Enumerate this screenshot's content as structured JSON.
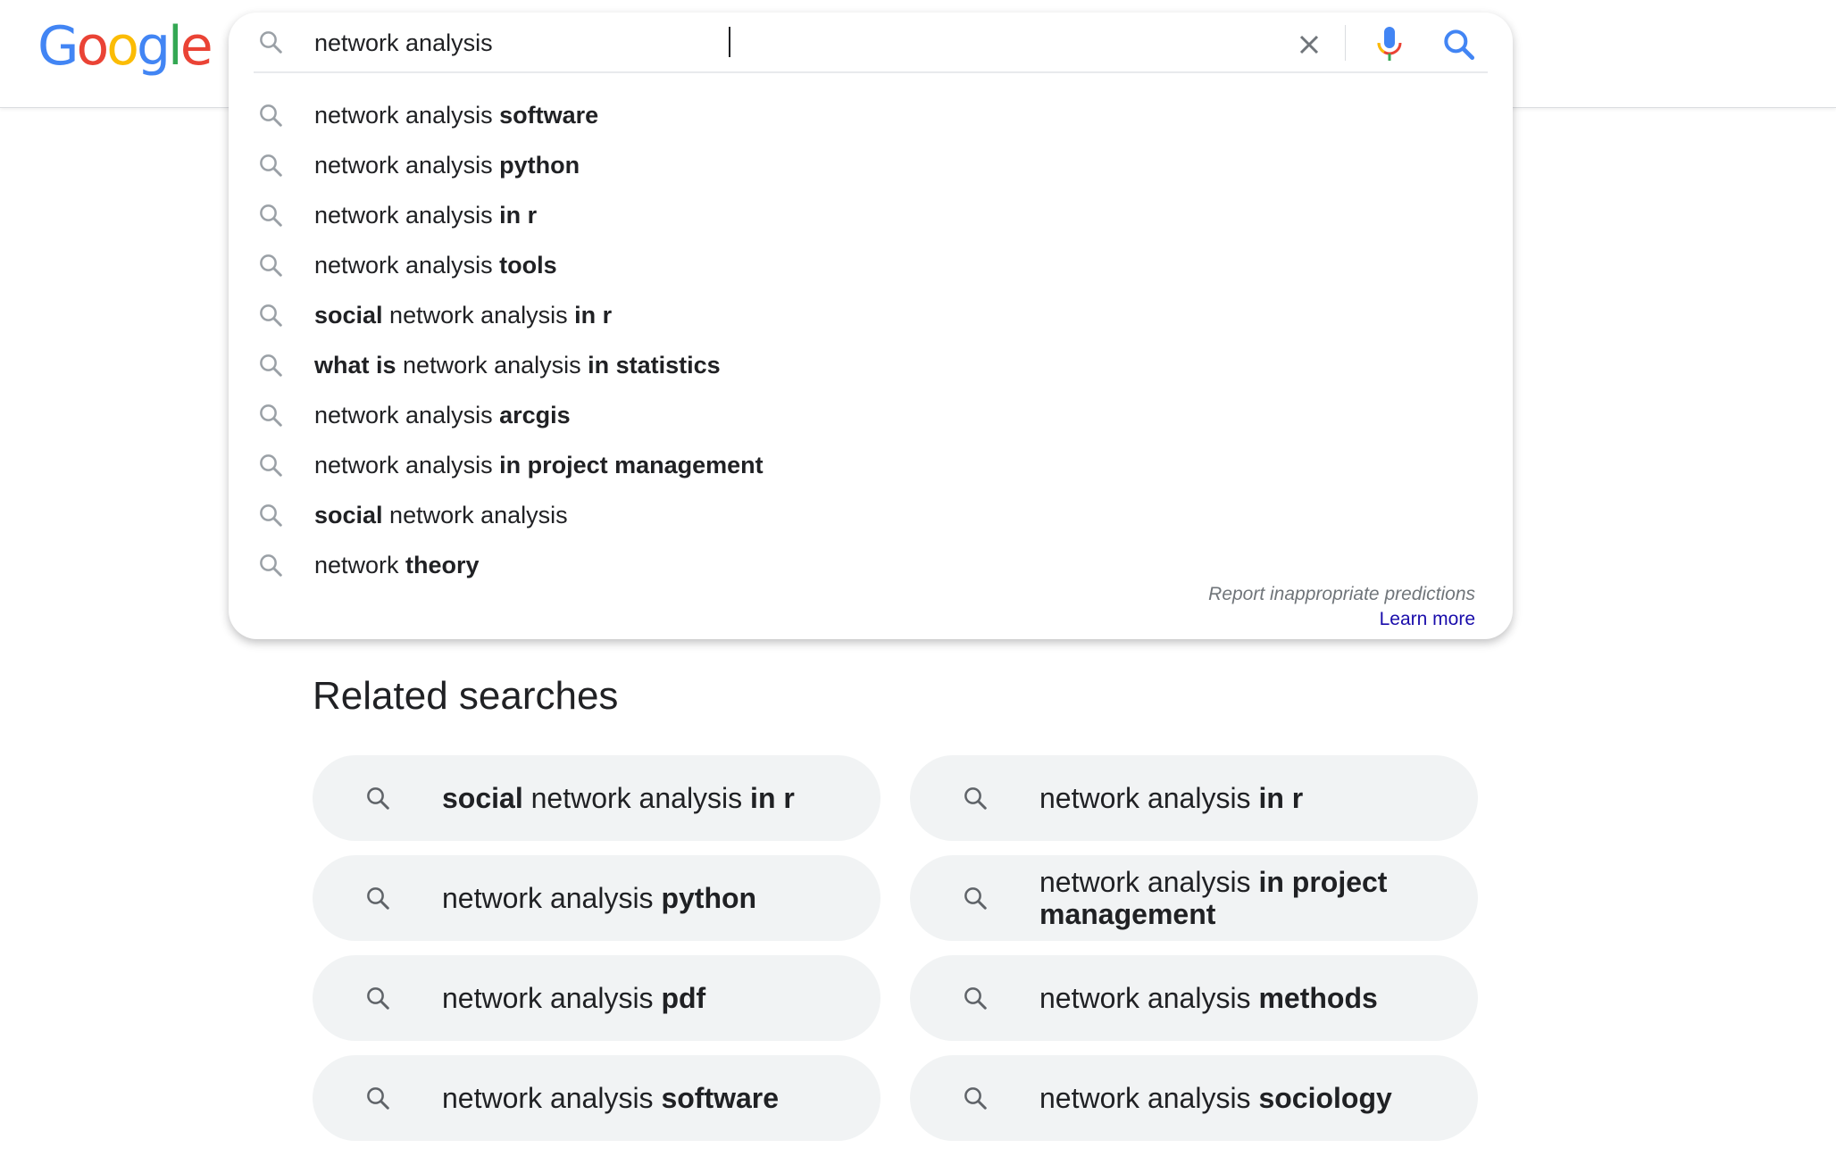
{
  "logo": {
    "letters": [
      {
        "ch": "G",
        "color": "#4285F4"
      },
      {
        "ch": "o",
        "color": "#EA4335"
      },
      {
        "ch": "o",
        "color": "#FBBC05"
      },
      {
        "ch": "g",
        "color": "#4285F4"
      },
      {
        "ch": "l",
        "color": "#34A853"
      },
      {
        "ch": "e",
        "color": "#EA4335"
      }
    ]
  },
  "search": {
    "query": "network analysis",
    "search_icon": "search-icon",
    "clear_icon": "close-icon",
    "mic_icon": "microphone-icon",
    "go_icon": "search-icon"
  },
  "suggestions": [
    {
      "parts": [
        {
          "t": "network analysis ",
          "b": false
        },
        {
          "t": "software",
          "b": true
        }
      ]
    },
    {
      "parts": [
        {
          "t": "network analysis ",
          "b": false
        },
        {
          "t": "python",
          "b": true
        }
      ]
    },
    {
      "parts": [
        {
          "t": "network analysis ",
          "b": false
        },
        {
          "t": "in r",
          "b": true
        }
      ]
    },
    {
      "parts": [
        {
          "t": "network analysis ",
          "b": false
        },
        {
          "t": "tools",
          "b": true
        }
      ]
    },
    {
      "parts": [
        {
          "t": "social",
          "b": true
        },
        {
          "t": " network analysis ",
          "b": false
        },
        {
          "t": "in r",
          "b": true
        }
      ]
    },
    {
      "parts": [
        {
          "t": "what is",
          "b": true
        },
        {
          "t": " network analysis ",
          "b": false
        },
        {
          "t": "in statistics",
          "b": true
        }
      ]
    },
    {
      "parts": [
        {
          "t": "network analysis ",
          "b": false
        },
        {
          "t": "arcgis",
          "b": true
        }
      ]
    },
    {
      "parts": [
        {
          "t": "network analysis ",
          "b": false
        },
        {
          "t": "in project management",
          "b": true
        }
      ]
    },
    {
      "parts": [
        {
          "t": "social",
          "b": true
        },
        {
          "t": " network analysis",
          "b": false
        }
      ]
    },
    {
      "parts": [
        {
          "t": "network ",
          "b": false
        },
        {
          "t": "theory",
          "b": true
        }
      ]
    }
  ],
  "footer": {
    "report": "Report inappropriate predictions",
    "learn_more": "Learn more"
  },
  "related": {
    "title": "Related searches",
    "items": [
      {
        "parts": [
          {
            "t": "social",
            "b": true
          },
          {
            "t": " network analysis ",
            "b": false
          },
          {
            "t": "in r",
            "b": true
          }
        ]
      },
      {
        "parts": [
          {
            "t": "network analysis ",
            "b": false
          },
          {
            "t": "in r",
            "b": true
          }
        ]
      },
      {
        "parts": [
          {
            "t": "network analysis ",
            "b": false
          },
          {
            "t": "python",
            "b": true
          }
        ]
      },
      {
        "parts": [
          {
            "t": "network analysis ",
            "b": false
          },
          {
            "t": "in project management",
            "b": true
          }
        ]
      },
      {
        "parts": [
          {
            "t": "network analysis ",
            "b": false
          },
          {
            "t": "pdf",
            "b": true
          }
        ]
      },
      {
        "parts": [
          {
            "t": "network analysis ",
            "b": false
          },
          {
            "t": "methods",
            "b": true
          }
        ]
      },
      {
        "parts": [
          {
            "t": "network analysis ",
            "b": false
          },
          {
            "t": "software",
            "b": true
          }
        ]
      },
      {
        "parts": [
          {
            "t": "network analysis ",
            "b": false
          },
          {
            "t": "sociology",
            "b": true
          }
        ]
      }
    ]
  },
  "colors": {
    "mic_blue": "#4285F4",
    "mic_red": "#EA4335",
    "mic_yellow": "#FBBC05",
    "mic_green": "#34A853",
    "link": "#1a0dab",
    "muted": "#70757a",
    "pill_bg": "#f1f3f4"
  }
}
